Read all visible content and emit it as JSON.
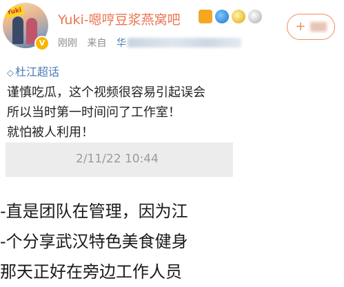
{
  "profile": {
    "username": "Yuki-嗯哼豆浆燕窝吧",
    "avatar_tag": "Yuki",
    "verified_mark": "V",
    "badges": [
      "crown-badge",
      "blue-badge",
      "gold-medal-badge",
      "silver-medal-badge"
    ]
  },
  "meta": {
    "time": "刚刚",
    "from_label": "来自",
    "source_prefix": "华"
  },
  "follow": {
    "plus": "+"
  },
  "topic": {
    "label": "杜江超话"
  },
  "post": {
    "lines": [
      "谨慎吃瓜，这个视频很容易引起误会",
      "所以当时第一时间问了工作室！",
      "就怕被人利用！"
    ]
  },
  "embedded_screenshot": {
    "date": "2/11/22 10:44",
    "lines": [
      "-直是团队在管理，因为江",
      "-个分享武汉特色美食健身",
      "那天正好在旁边工作人员"
    ]
  },
  "colors": {
    "username": "#eb7350",
    "link": "#4a7ab5",
    "meta": "#8c8c8c",
    "follow_border": "#f08c5a"
  }
}
